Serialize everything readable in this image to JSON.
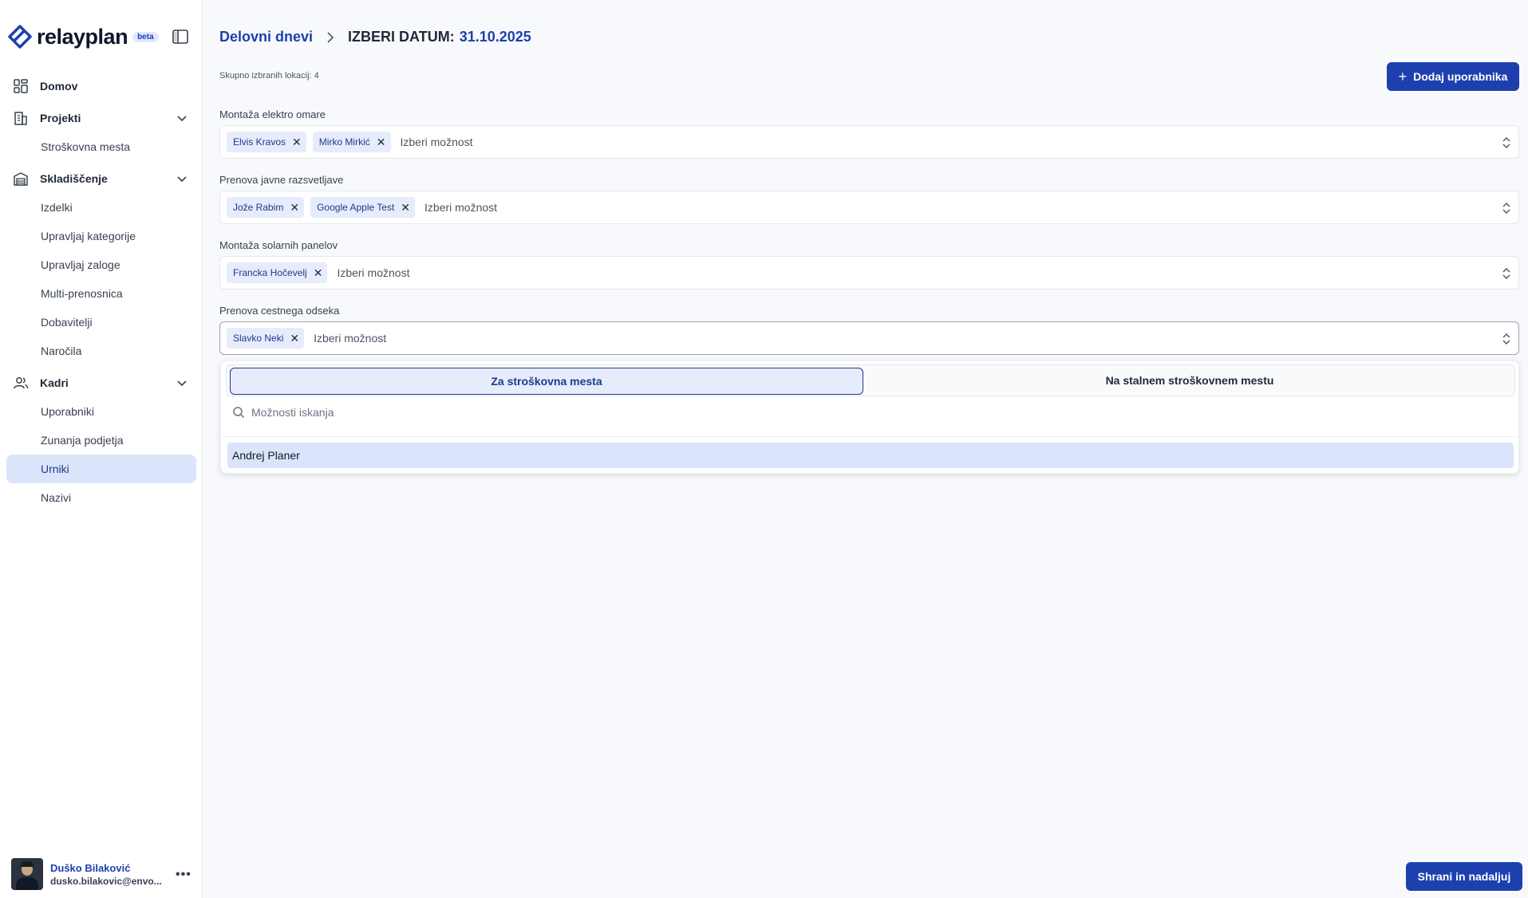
{
  "brand": {
    "name": "relayplan",
    "badge": "beta"
  },
  "sidebar": {
    "groups": [
      {
        "label": "Domov",
        "icon": "dashboard-icon",
        "items": []
      },
      {
        "label": "Projekti",
        "icon": "building-icon",
        "items": [
          "Stroškovna mesta"
        ]
      },
      {
        "label": "Skladiščenje",
        "icon": "warehouse-icon",
        "items": [
          "Izdelki",
          "Upravljaj kategorije",
          "Upravljaj zaloge",
          "Multi-prenosnica",
          "Dobavitelji",
          "Naročila"
        ]
      },
      {
        "label": "Kadri",
        "icon": "users-icon",
        "items": [
          "Uporabniki",
          "Zunanja podjetja",
          "Urniki",
          "Nazivi"
        ]
      }
    ],
    "active_item": "Urniki"
  },
  "user": {
    "name": "Duško Bilaković",
    "email": "dusko.bilakovic@envo..."
  },
  "breadcrumb": {
    "link": "Delovni dnevi",
    "prefix": "IZBERI DATUM:",
    "date": "31.10.2025"
  },
  "summary": {
    "total_locations": "Skupno izbranih lokacij: 4"
  },
  "buttons": {
    "add_user": "Dodaj uporabnika",
    "save": "Shrani in nadaljuj"
  },
  "locations": [
    {
      "label": "Montaža elektro omare",
      "chips": [
        "Elvis Kravos",
        "Mirko Mirkić"
      ],
      "placeholder": "Izberi možnost"
    },
    {
      "label": "Prenova javne razsvetljave",
      "chips": [
        "Jože Rabim",
        "Google Apple Test"
      ],
      "placeholder": "Izberi možnost"
    },
    {
      "label": "Montaža solarnih panelov",
      "chips": [
        "Francka Hočevelj"
      ],
      "placeholder": "Izberi možnost"
    },
    {
      "label": "Prenova cestnega odseka",
      "chips": [
        "Slavko Neki"
      ],
      "placeholder": "Izberi možnost"
    }
  ],
  "dropdown": {
    "tabs": [
      "Za stroškovna mesta",
      "Na stalnem stroškovnem mestu"
    ],
    "active_tab": "Za stroškovna mesta",
    "search_placeholder": "Možnosti iskanja",
    "options": [
      "Andrej Planer"
    ]
  },
  "colors": {
    "primary": "#1e40af",
    "chip_bg": "#e6ecfb",
    "active_nav_bg": "#dbe4fb",
    "page_bg": "#f8f9fc"
  }
}
